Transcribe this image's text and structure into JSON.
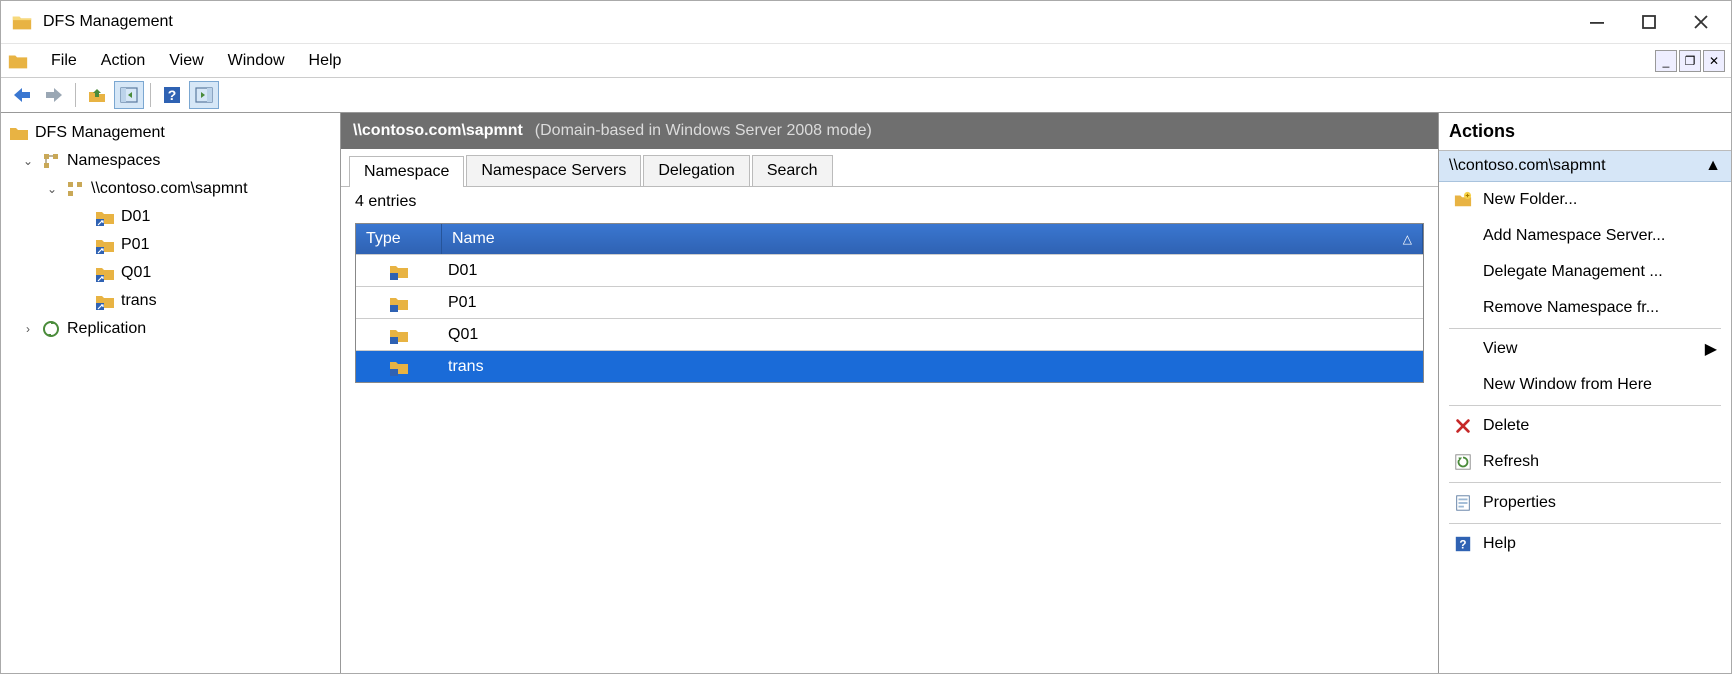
{
  "window": {
    "title": "DFS Management"
  },
  "menu": {
    "items": [
      "File",
      "Action",
      "View",
      "Window",
      "Help"
    ]
  },
  "tree": {
    "root": "DFS Management",
    "namespaces": {
      "label": "Namespaces",
      "selected_namespace": "\\\\contoso.com\\sapmnt",
      "children": [
        "D01",
        "P01",
        "Q01",
        "trans"
      ]
    },
    "replication": "Replication"
  },
  "content": {
    "title": "\\\\contoso.com\\sapmnt",
    "mode": "(Domain-based in Windows Server 2008 mode)",
    "tabs": [
      "Namespace",
      "Namespace Servers",
      "Delegation",
      "Search"
    ],
    "entries_label": "4 entries",
    "columns": {
      "type": "Type",
      "name": "Name"
    },
    "rows": [
      "D01",
      "P01",
      "Q01",
      "trans"
    ],
    "selected_row": "trans"
  },
  "actions": {
    "title": "Actions",
    "context": "\\\\contoso.com\\sapmnt",
    "items": [
      "New Folder...",
      "Add Namespace Server...",
      "Delegate Management ...",
      "Remove Namespace fr...",
      "View",
      "New Window from Here",
      "Delete",
      "Refresh",
      "Properties",
      "Help"
    ]
  }
}
